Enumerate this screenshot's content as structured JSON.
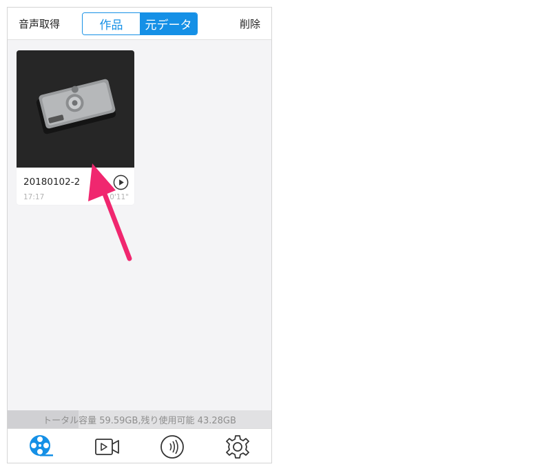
{
  "navbar": {
    "left_label": "音声取得",
    "right_label": "削除",
    "segments": [
      {
        "label": "作品",
        "active": false
      },
      {
        "label": "元データ",
        "active": true
      }
    ]
  },
  "items": [
    {
      "title": "20180102-2",
      "time": "17:17",
      "duration": "0'11\""
    }
  ],
  "storage": {
    "text": "トータル容量 59.59GB,残り使用可能 43.28GB",
    "used_fraction": 0.27
  },
  "tabbar": {
    "tabs": [
      {
        "icon": "film-reel-icon",
        "active": true
      },
      {
        "icon": "video-camera-icon",
        "active": false
      },
      {
        "icon": "audio-wave-icon",
        "active": false
      },
      {
        "icon": "gear-icon",
        "active": false
      }
    ]
  },
  "colors": {
    "accent": "#1590e6",
    "annotation_arrow": "#f0276f"
  }
}
